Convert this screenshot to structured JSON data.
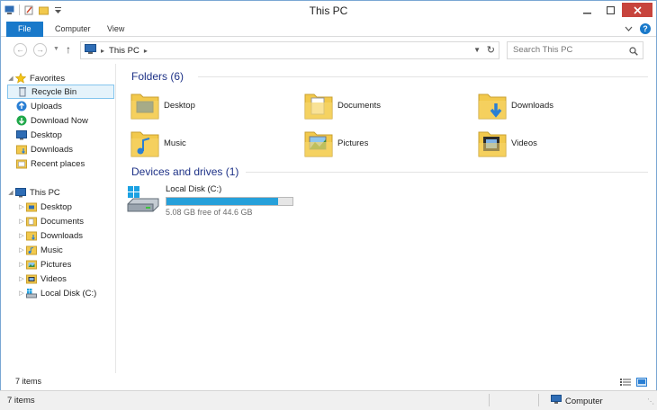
{
  "window": {
    "title": "This PC"
  },
  "ribbon": {
    "tabs": [
      "File",
      "Computer",
      "View"
    ]
  },
  "address": {
    "location": "This PC",
    "search_placeholder": "Search This PC"
  },
  "nav": {
    "favorites_label": "Favorites",
    "favorites": [
      "Recycle Bin",
      "Uploads",
      "Download Now",
      "Desktop",
      "Downloads",
      "Recent places"
    ],
    "thispc_label": "This PC",
    "thispc_items": [
      "Desktop",
      "Documents",
      "Downloads",
      "Music",
      "Pictures",
      "Videos",
      "Local Disk (C:)"
    ]
  },
  "content": {
    "folders_header": "Folders (6)",
    "folders": [
      "Desktop",
      "Documents",
      "Downloads",
      "Music",
      "Pictures",
      "Videos"
    ],
    "devices_header": "Devices and drives (1)",
    "drive": {
      "name": "Local Disk (C:)",
      "free_text": "5.08 GB free of 44.6 GB",
      "used_fraction": 0.886
    }
  },
  "status": {
    "pane_count": "7 items",
    "bar_count": "7 items",
    "zone": "Computer"
  },
  "colors": {
    "accent": "#1979ca",
    "drive_fill": "#26a0da",
    "close_button": "#c7443d",
    "header_text": "#1e3287",
    "folder": "#f2c94c"
  }
}
